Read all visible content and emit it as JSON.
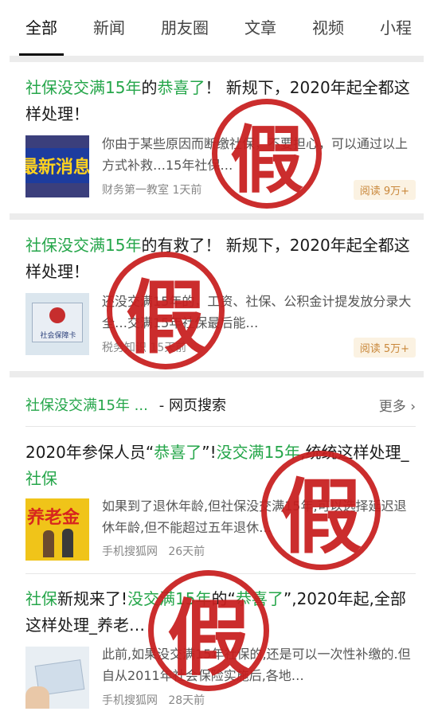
{
  "tabs": [
    "全部",
    "新闻",
    "朋友圈",
    "文章",
    "视频",
    "小程"
  ],
  "articles": [
    {
      "title_parts": [
        {
          "t": "社保没交满15年",
          "hl": true
        },
        {
          "t": "的",
          "hl": false
        },
        {
          "t": "恭喜了",
          "hl": true
        },
        {
          "t": "！ 新规下，2020年起全都这样处理！",
          "hl": false
        }
      ],
      "thumb_text": "最新消息",
      "desc": "你由于某些原因而断缴社保，不要担心，可以通过以上方式补救…15年社保…",
      "source": "财务第一教室",
      "time": "1天前",
      "reads": "阅读 9万+"
    },
    {
      "title_parts": [
        {
          "t": "社保没交满15年",
          "hl": true
        },
        {
          "t": "的有救了！ 新规下，2020年起全都这样处理！",
          "hl": false
        }
      ],
      "thumb_text": "社会保障卡",
      "desc": "还没交满15年的，工资、社保、公积金计提发放分录大全…交满15年社保最后能…",
      "source": "税务知识",
      "time": "15天前",
      "reads": "阅读 5万+"
    }
  ],
  "search_section": {
    "query": "社保没交满15年 ...",
    "label": " - 网页搜索",
    "more": "更多"
  },
  "results": [
    {
      "title_parts": [
        {
          "t": "2020年参保人员“",
          "hl": false
        },
        {
          "t": "恭喜了",
          "hl": true
        },
        {
          "t": "”!",
          "hl": false
        },
        {
          "t": "没交满15年",
          "hl": true
        },
        {
          "t": ",统统这样处理_",
          "hl": false
        },
        {
          "t": "社保",
          "hl": true
        }
      ],
      "thumb_text": "养老金",
      "desc": "如果到了退休年龄,但社保没交满15年,可以选择延迟退休年龄,但不能超过五年退休…",
      "source": "手机搜狐网",
      "time": "26天前"
    },
    {
      "title_parts": [
        {
          "t": "社保",
          "hl": true
        },
        {
          "t": "新规来了!",
          "hl": false
        },
        {
          "t": "没交满15年",
          "hl": true
        },
        {
          "t": "的“",
          "hl": false
        },
        {
          "t": "恭喜了",
          "hl": true
        },
        {
          "t": "”,2020年起,全部这样处理_养老…",
          "hl": false
        }
      ],
      "thumb_text": "",
      "desc": "此前,如果没交满15年社保的,还是可以一次性补缴的.但自从2011年社会保险实施后,各地…",
      "source": "手机搜狐网",
      "time": "28天前"
    }
  ],
  "stamp_char": "假",
  "colors": {
    "highlight": "#25a64a",
    "stamp": "#c81e1e",
    "badge_text": "#c9873a"
  }
}
